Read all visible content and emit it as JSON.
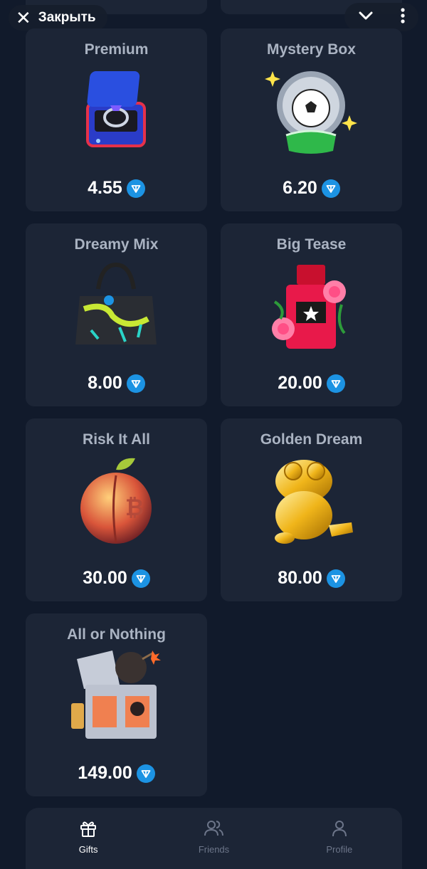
{
  "topbar": {
    "close_label": "Закрыть"
  },
  "gifts": [
    {
      "name": "Premium",
      "price": "4.55",
      "icon": "ring-box-icon"
    },
    {
      "name": "Mystery Box",
      "price": "6.20",
      "icon": "snow-globe-ball-icon"
    },
    {
      "name": "Dreamy Mix",
      "price": "8.00",
      "icon": "handbag-icon"
    },
    {
      "name": "Big Tease",
      "price": "20.00",
      "icon": "perfume-bottle-icon"
    },
    {
      "name": "Risk It All",
      "price": "30.00",
      "icon": "peach-bitcoin-icon"
    },
    {
      "name": "Golden Dream",
      "price": "80.00",
      "icon": "golden-frog-icon"
    },
    {
      "name": "All or Nothing",
      "price": "149.00",
      "icon": "bomb-box-icon"
    }
  ],
  "nav": [
    {
      "label": "Gifts",
      "icon": "gift-icon",
      "active": true
    },
    {
      "label": "Friends",
      "icon": "friends-icon",
      "active": false
    },
    {
      "label": "Profile",
      "icon": "profile-icon",
      "active": false
    }
  ],
  "colors": {
    "background": "#111a2b",
    "card": "#1c2536",
    "ton": "#1c93e3",
    "muted": "#aab3c2"
  }
}
